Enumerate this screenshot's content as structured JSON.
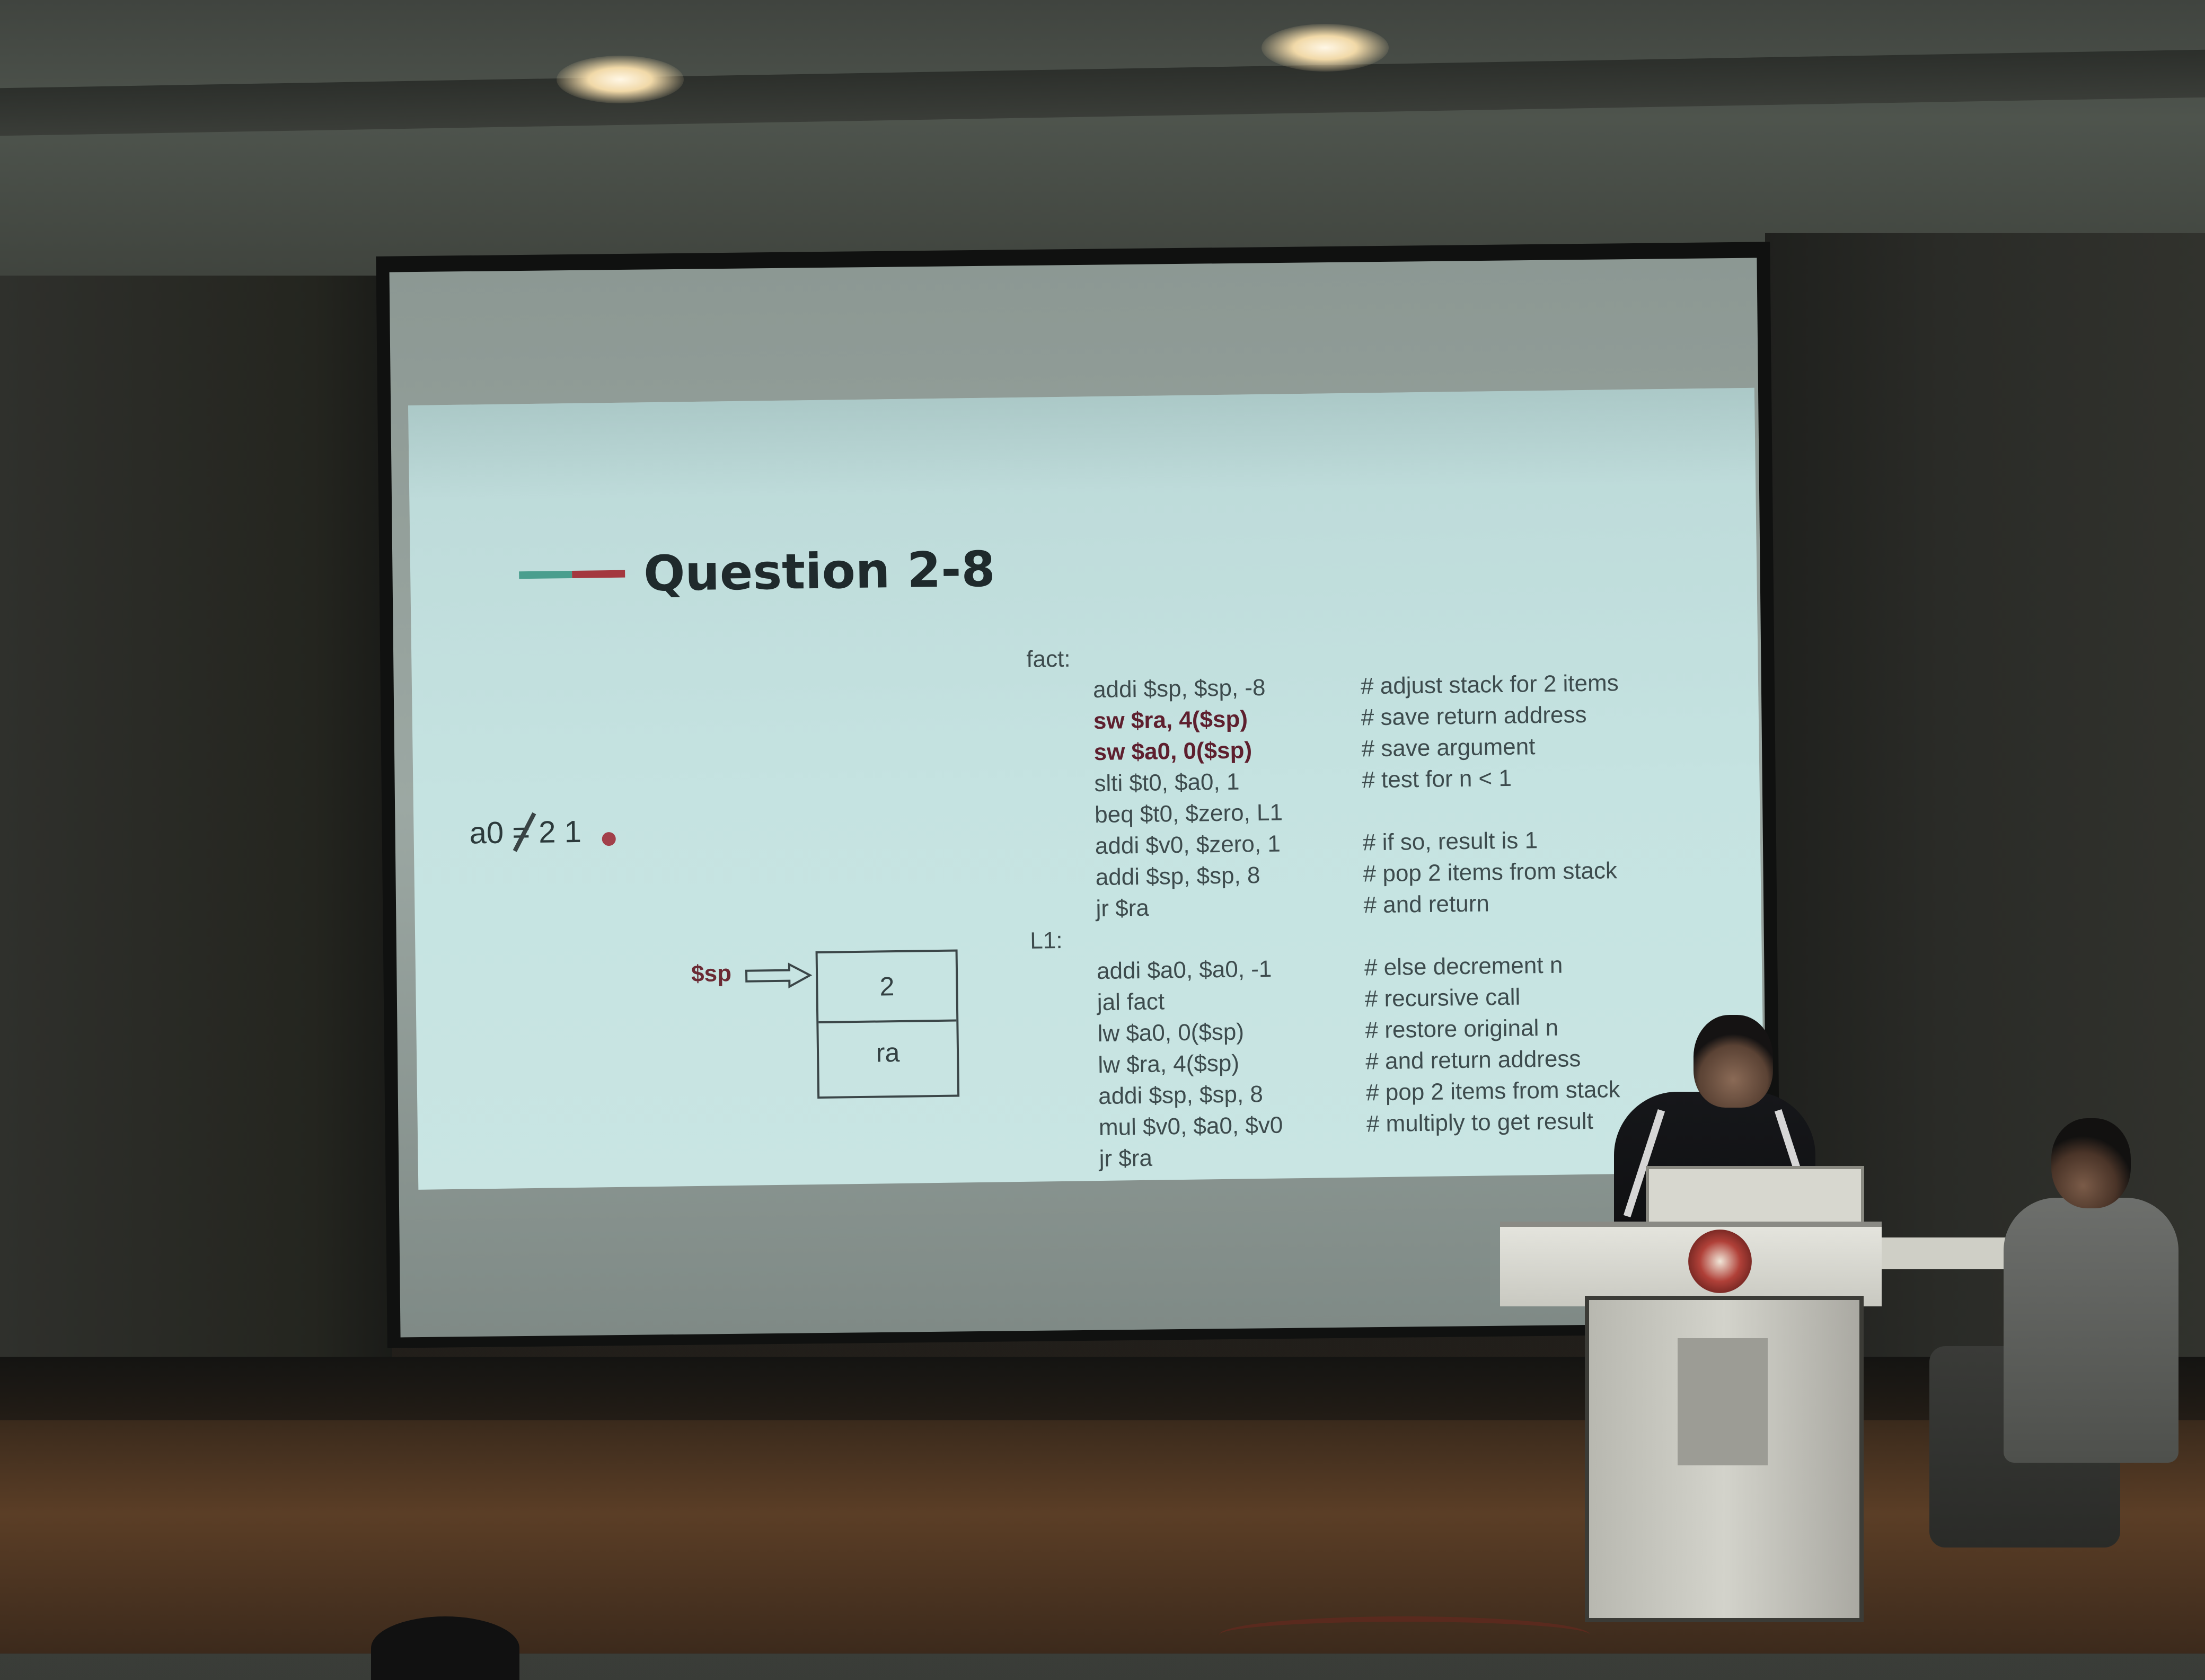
{
  "slide": {
    "title": "Question 2-8",
    "accent_colors": [
      "#4a9e8e",
      "#a4383f"
    ],
    "annotation": {
      "prefix": "a0 = ",
      "crossed_value": "2",
      "new_value": "1"
    },
    "stack": {
      "pointer_label": "$sp",
      "cells": [
        "2",
        "ra"
      ]
    },
    "code": [
      {
        "label": "fact:",
        "instr": "",
        "comment": ""
      },
      {
        "label": "",
        "instr": "addi $sp, $sp, -8",
        "comment": "# adjust stack for 2 items",
        "highlight": false
      },
      {
        "label": "",
        "instr": "sw  $ra, 4($sp)",
        "comment": "# save return address",
        "highlight": true
      },
      {
        "label": "",
        "instr": "sw  $a0, 0($sp)",
        "comment": "# save argument",
        "highlight": true
      },
      {
        "label": "",
        "instr": "slti $t0, $a0, 1",
        "comment": "# test for n < 1",
        "highlight": false
      },
      {
        "label": "",
        "instr": "beq $t0, $zero, L1",
        "comment": "",
        "highlight": false
      },
      {
        "label": "",
        "instr": "addi $v0, $zero, 1",
        "comment": "# if so, result is 1",
        "highlight": false
      },
      {
        "label": "",
        "instr": "addi $sp, $sp, 8",
        "comment": "#  pop 2 items from stack",
        "highlight": false
      },
      {
        "label": "",
        "instr": "jr  $ra",
        "comment": "#  and return",
        "highlight": false
      },
      {
        "label": "L1:",
        "instr": "",
        "comment": ""
      },
      {
        "label": "",
        "instr": "addi $a0, $a0, -1",
        "comment": "# else decrement n",
        "highlight": false
      },
      {
        "label": "",
        "instr": "jal fact",
        "comment": "# recursive call",
        "highlight": false
      },
      {
        "label": "",
        "instr": "lw  $a0, 0($sp)",
        "comment": "# restore original n",
        "highlight": false
      },
      {
        "label": "",
        "instr": "lw  $ra, 4($sp)",
        "comment": "#  and return address",
        "highlight": false
      },
      {
        "label": "",
        "instr": "addi $sp, $sp, 8",
        "comment": "# pop 2 items from stack",
        "highlight": false
      },
      {
        "label": "",
        "instr": "mul  $v0, $a0, $v0",
        "comment": "# multiply to get result",
        "highlight": false
      },
      {
        "label": "",
        "instr": "jr  $ra",
        "comment": "",
        "highlight": false
      }
    ]
  }
}
